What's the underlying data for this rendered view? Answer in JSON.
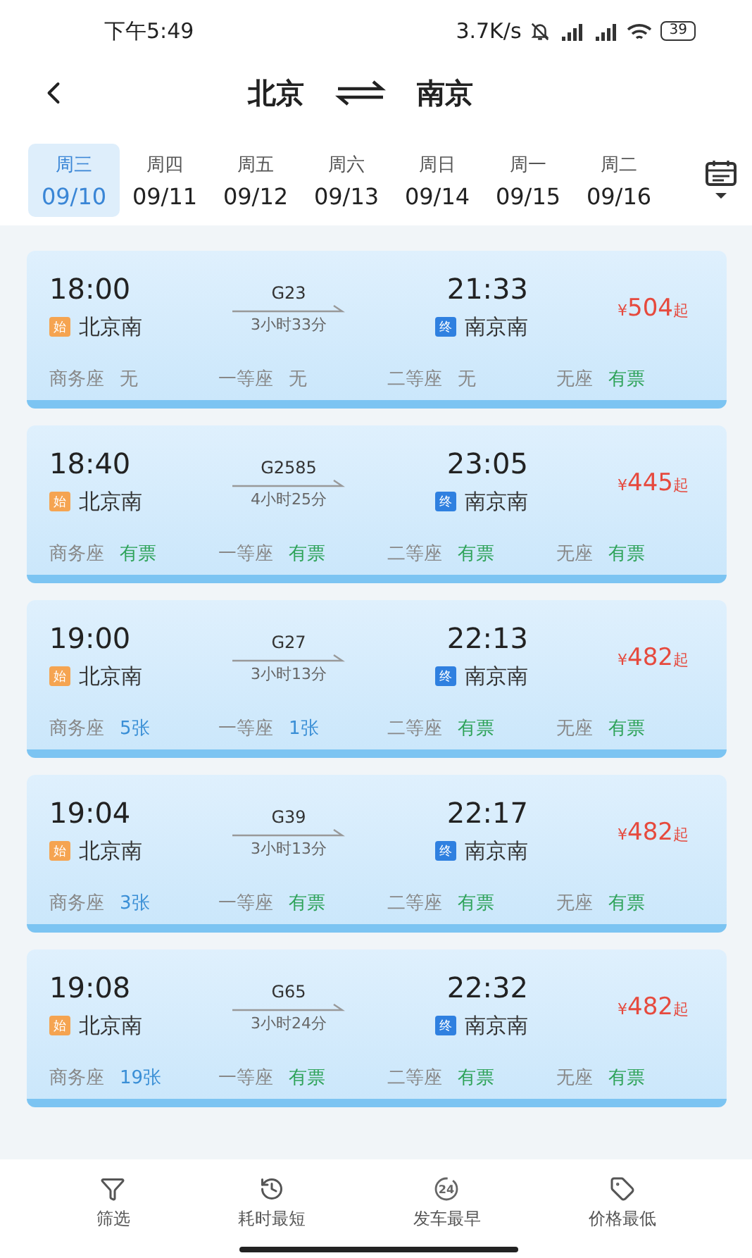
{
  "status_bar": {
    "time": "下午5:49",
    "speed": "3.7K/s",
    "battery": "39"
  },
  "header": {
    "from": "北京",
    "to": "南京"
  },
  "dates": [
    {
      "weekday": "周三",
      "date": "09/10",
      "selected": true
    },
    {
      "weekday": "周四",
      "date": "09/11",
      "selected": false
    },
    {
      "weekday": "周五",
      "date": "09/12",
      "selected": false
    },
    {
      "weekday": "周六",
      "date": "09/13",
      "selected": false
    },
    {
      "weekday": "周日",
      "date": "09/14",
      "selected": false
    },
    {
      "weekday": "周一",
      "date": "09/15",
      "selected": false
    },
    {
      "weekday": "周二",
      "date": "09/16",
      "selected": false
    }
  ],
  "trains": [
    {
      "depart": "18:00",
      "train": "G23",
      "duration": "3小时33分",
      "arrive": "21:33",
      "start_tag": "始",
      "from": "北京南",
      "end_tag": "终",
      "to": "南京南",
      "currency": "¥",
      "price": "504",
      "price_suffix": "起",
      "seats": [
        {
          "name": "商务座",
          "status": "无",
          "kind": "none"
        },
        {
          "name": "一等座",
          "status": "无",
          "kind": "none"
        },
        {
          "name": "二等座",
          "status": "无",
          "kind": "none"
        },
        {
          "name": "无座",
          "status": "有票",
          "kind": "available"
        }
      ]
    },
    {
      "depart": "18:40",
      "train": "G2585",
      "duration": "4小时25分",
      "arrive": "23:05",
      "start_tag": "始",
      "from": "北京南",
      "end_tag": "终",
      "to": "南京南",
      "currency": "¥",
      "price": "445",
      "price_suffix": "起",
      "seats": [
        {
          "name": "商务座",
          "status": "有票",
          "kind": "available"
        },
        {
          "name": "一等座",
          "status": "有票",
          "kind": "available"
        },
        {
          "name": "二等座",
          "status": "有票",
          "kind": "available"
        },
        {
          "name": "无座",
          "status": "有票",
          "kind": "available"
        }
      ]
    },
    {
      "depart": "19:00",
      "train": "G27",
      "duration": "3小时13分",
      "arrive": "22:13",
      "start_tag": "始",
      "from": "北京南",
      "end_tag": "终",
      "to": "南京南",
      "currency": "¥",
      "price": "482",
      "price_suffix": "起",
      "seats": [
        {
          "name": "商务座",
          "status": "5张",
          "kind": "count"
        },
        {
          "name": "一等座",
          "status": "1张",
          "kind": "count"
        },
        {
          "name": "二等座",
          "status": "有票",
          "kind": "available"
        },
        {
          "name": "无座",
          "status": "有票",
          "kind": "available"
        }
      ]
    },
    {
      "depart": "19:04",
      "train": "G39",
      "duration": "3小时13分",
      "arrive": "22:17",
      "start_tag": "始",
      "from": "北京南",
      "end_tag": "终",
      "to": "南京南",
      "currency": "¥",
      "price": "482",
      "price_suffix": "起",
      "seats": [
        {
          "name": "商务座",
          "status": "3张",
          "kind": "count"
        },
        {
          "name": "一等座",
          "status": "有票",
          "kind": "available"
        },
        {
          "name": "二等座",
          "status": "有票",
          "kind": "available"
        },
        {
          "name": "无座",
          "status": "有票",
          "kind": "available"
        }
      ]
    },
    {
      "depart": "19:08",
      "train": "G65",
      "duration": "3小时24分",
      "arrive": "22:32",
      "start_tag": "始",
      "from": "北京南",
      "end_tag": "终",
      "to": "南京南",
      "currency": "¥",
      "price": "482",
      "price_suffix": "起",
      "seats": [
        {
          "name": "商务座",
          "status": "19张",
          "kind": "count"
        },
        {
          "name": "一等座",
          "status": "有票",
          "kind": "available"
        },
        {
          "name": "二等座",
          "status": "有票",
          "kind": "available"
        },
        {
          "name": "无座",
          "status": "有票",
          "kind": "available"
        }
      ]
    }
  ],
  "bottom_bar": [
    {
      "label": "筛选",
      "kind": "filter"
    },
    {
      "label": "耗时最短",
      "kind": "history"
    },
    {
      "label": "发车最早",
      "kind": "clock",
      "icon_text": "24"
    },
    {
      "label": "价格最低",
      "kind": "tag"
    }
  ]
}
